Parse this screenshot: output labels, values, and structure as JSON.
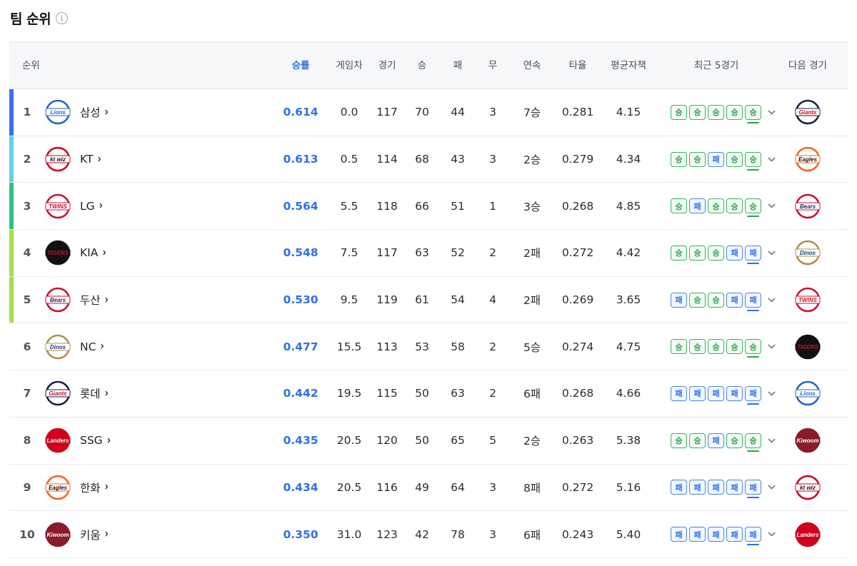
{
  "title": "팀 순위",
  "info_icon": "i",
  "columns": {
    "rank": "순위",
    "pct": "승률",
    "gb": "게임차",
    "games": "경기",
    "wins": "승",
    "losses": "패",
    "draws": "무",
    "streak": "연속",
    "avg": "타율",
    "era": "평균자책",
    "recent5": "최근 5경기",
    "next": "다음 경기"
  },
  "result_labels": {
    "W": "승",
    "L": "패"
  },
  "colors": {
    "accent": "#2f6ff0",
    "win": "#2ea14e",
    "loss": "#2f6ff0",
    "rank_bar_1": "#3b6ff0",
    "rank_bar_2": "#5fd3e6",
    "rank_bar_3": "#2ec27e",
    "rank_bar_45": "#a8dc4a"
  },
  "logos": {
    "lions": {
      "text": "Lions",
      "fg": "#1f67c4",
      "bg": "#ffffff",
      "ring": "#1f67c4"
    },
    "ktwiz": {
      "text": "kt wiz",
      "fg": "#111111",
      "bg": "#ffffff",
      "ring": "#d0021b"
    },
    "twins": {
      "text": "TWINS",
      "fg": "#c8102e",
      "bg": "#ffffff",
      "ring": "#c8102e"
    },
    "tigers": {
      "text": "TIGERS",
      "fg": "#c8102e",
      "bg": "#111111",
      "ring": "#111111"
    },
    "bears": {
      "text": "Bears",
      "fg": "#1b2a5c",
      "bg": "#ffffff",
      "ring": "#c8102e"
    },
    "dinos": {
      "text": "Dinos",
      "fg": "#1b3a6b",
      "bg": "#ffffff",
      "ring": "#b08d57"
    },
    "giants": {
      "text": "Giants",
      "fg": "#d0021b",
      "bg": "#ffffff",
      "ring": "#14213d"
    },
    "landers": {
      "text": "Landers",
      "fg": "#ffffff",
      "bg": "#d0021b",
      "ring": "#d0021b"
    },
    "eagles": {
      "text": "Eagles",
      "fg": "#111111",
      "bg": "#ffffff",
      "ring": "#f26522"
    },
    "kiwoom": {
      "text": "Kiwoom",
      "fg": "#ffffff",
      "bg": "#8b1a2b",
      "ring": "#8b1a2b"
    }
  },
  "rows": [
    {
      "rank": "1",
      "team": "삼성",
      "logo": "lions",
      "pct": "0.614",
      "gb": "0.0",
      "games": "117",
      "wins": "70",
      "losses": "44",
      "draws": "3",
      "streak": "7승",
      "avg": "0.281",
      "era": "4.15",
      "recent": [
        "W",
        "W",
        "W",
        "W",
        "W"
      ],
      "next": "giants",
      "bar": "rank_bar_1"
    },
    {
      "rank": "2",
      "team": "KT",
      "logo": "ktwiz",
      "pct": "0.613",
      "gb": "0.5",
      "games": "114",
      "wins": "68",
      "losses": "43",
      "draws": "3",
      "streak": "2승",
      "avg": "0.279",
      "era": "4.34",
      "recent": [
        "W",
        "W",
        "L",
        "W",
        "W"
      ],
      "next": "eagles",
      "bar": "rank_bar_2"
    },
    {
      "rank": "3",
      "team": "LG",
      "logo": "twins",
      "pct": "0.564",
      "gb": "5.5",
      "games": "118",
      "wins": "66",
      "losses": "51",
      "draws": "1",
      "streak": "3승",
      "avg": "0.268",
      "era": "4.85",
      "recent": [
        "W",
        "L",
        "W",
        "W",
        "W"
      ],
      "next": "bears",
      "bar": "rank_bar_3"
    },
    {
      "rank": "4",
      "team": "KIA",
      "logo": "tigers",
      "pct": "0.548",
      "gb": "7.5",
      "games": "117",
      "wins": "63",
      "losses": "52",
      "draws": "2",
      "streak": "2패",
      "avg": "0.272",
      "era": "4.42",
      "recent": [
        "W",
        "W",
        "W",
        "L",
        "L"
      ],
      "next": "dinos",
      "bar": "rank_bar_45"
    },
    {
      "rank": "5",
      "team": "두산",
      "logo": "bears",
      "pct": "0.530",
      "gb": "9.5",
      "games": "119",
      "wins": "61",
      "losses": "54",
      "draws": "4",
      "streak": "2패",
      "avg": "0.269",
      "era": "3.65",
      "recent": [
        "L",
        "W",
        "W",
        "L",
        "L"
      ],
      "next": "twins",
      "bar": "rank_bar_45"
    },
    {
      "rank": "6",
      "team": "NC",
      "logo": "dinos",
      "pct": "0.477",
      "gb": "15.5",
      "games": "113",
      "wins": "53",
      "losses": "58",
      "draws": "2",
      "streak": "5승",
      "avg": "0.274",
      "era": "4.75",
      "recent": [
        "W",
        "W",
        "W",
        "W",
        "W"
      ],
      "next": "tigers",
      "bar": ""
    },
    {
      "rank": "7",
      "team": "롯데",
      "logo": "giants",
      "pct": "0.442",
      "gb": "19.5",
      "games": "115",
      "wins": "50",
      "losses": "63",
      "draws": "2",
      "streak": "6패",
      "avg": "0.268",
      "era": "4.66",
      "recent": [
        "L",
        "L",
        "L",
        "L",
        "L"
      ],
      "next": "lions",
      "bar": ""
    },
    {
      "rank": "8",
      "team": "SSG",
      "logo": "landers",
      "pct": "0.435",
      "gb": "20.5",
      "games": "120",
      "wins": "50",
      "losses": "65",
      "draws": "5",
      "streak": "2승",
      "avg": "0.263",
      "era": "5.38",
      "recent": [
        "W",
        "W",
        "L",
        "W",
        "W"
      ],
      "next": "kiwoom",
      "bar": ""
    },
    {
      "rank": "9",
      "team": "한화",
      "logo": "eagles",
      "pct": "0.434",
      "gb": "20.5",
      "games": "116",
      "wins": "49",
      "losses": "64",
      "draws": "3",
      "streak": "8패",
      "avg": "0.272",
      "era": "5.16",
      "recent": [
        "L",
        "L",
        "L",
        "L",
        "L"
      ],
      "next": "ktwiz",
      "bar": ""
    },
    {
      "rank": "10",
      "team": "키움",
      "logo": "kiwoom",
      "pct": "0.350",
      "gb": "31.0",
      "games": "123",
      "wins": "42",
      "losses": "78",
      "draws": "3",
      "streak": "6패",
      "avg": "0.243",
      "era": "5.40",
      "recent": [
        "L",
        "L",
        "L",
        "L",
        "L"
      ],
      "next": "landers",
      "bar": ""
    }
  ]
}
